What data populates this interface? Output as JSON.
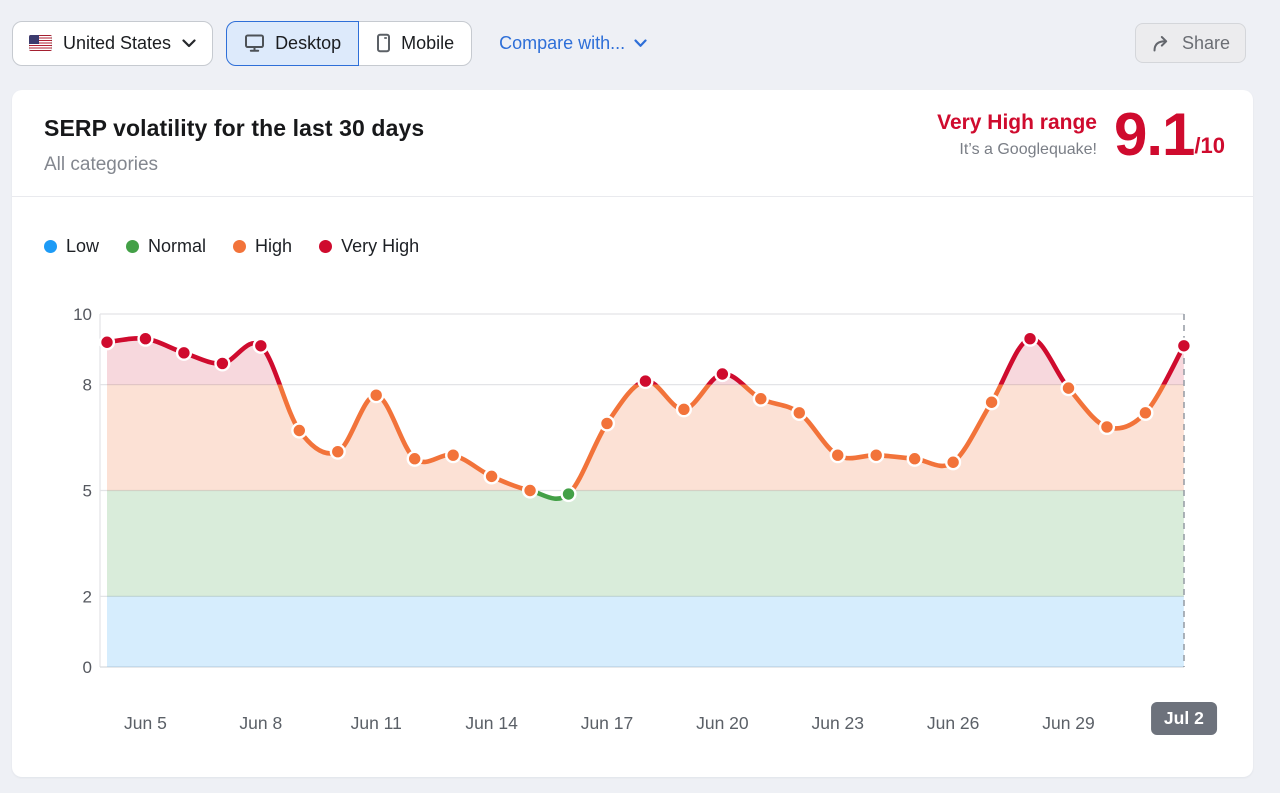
{
  "toolbar": {
    "country_selector": {
      "label": "United States",
      "flag_icon": "us-flag",
      "chevron_icon": "chevron-down"
    },
    "device_toggle": {
      "desktop_label": "Desktop",
      "mobile_label": "Mobile",
      "selected": "Desktop",
      "desktop_icon": "monitor",
      "mobile_icon": "smartphone"
    },
    "compare": {
      "label": "Compare with...",
      "chevron_icon": "chevron-down"
    },
    "share": {
      "label": "Share",
      "icon": "share-arrow"
    }
  },
  "card": {
    "title": "SERP volatility for the last 30 days",
    "subtitle": "All categories",
    "score": {
      "range_label": "Very High range",
      "caption": "It’s a Googlequake!",
      "value": "9.1",
      "out_of": "/10",
      "color": "#cf0b2e"
    }
  },
  "legend": {
    "items": [
      {
        "label": "Low",
        "color": "#1d9bf6"
      },
      {
        "label": "Normal",
        "color": "#43a047"
      },
      {
        "label": "High",
        "color": "#f2733a"
      },
      {
        "label": "Very High",
        "color": "#cf0b2e"
      }
    ]
  },
  "chart_data": {
    "type": "area",
    "title": "SERP volatility for the last 30 days",
    "x": [
      "Jun 4",
      "Jun 5",
      "Jun 6",
      "Jun 7",
      "Jun 8",
      "Jun 9",
      "Jun 10",
      "Jun 11",
      "Jun 12",
      "Jun 13",
      "Jun 14",
      "Jun 15",
      "Jun 16",
      "Jun 17",
      "Jun 18",
      "Jun 19",
      "Jun 20",
      "Jun 21",
      "Jun 22",
      "Jun 23",
      "Jun 24",
      "Jun 25",
      "Jun 26",
      "Jun 27",
      "Jun 28",
      "Jun 29",
      "Jun 30",
      "Jul 1",
      "Jul 2"
    ],
    "values": [
      9.2,
      9.3,
      8.9,
      8.6,
      9.1,
      6.7,
      6.1,
      7.7,
      5.9,
      6.0,
      5.4,
      5.0,
      4.9,
      6.9,
      8.1,
      7.3,
      8.3,
      7.6,
      7.2,
      6.0,
      6.0,
      5.9,
      5.8,
      7.5,
      9.3,
      7.9,
      6.8,
      7.2,
      9.1
    ],
    "ylim": [
      0,
      10
    ],
    "y_ticks": [
      0,
      2,
      5,
      8,
      10
    ],
    "x_tick_indices": [
      1,
      4,
      7,
      10,
      13,
      16,
      19,
      22,
      25,
      28
    ],
    "highlighted_x_label": "Jul 2",
    "grid": true,
    "legend_position": "top-left",
    "current_day_marker": "Jul 2",
    "zones": [
      {
        "name": "Low",
        "range": [
          0,
          2
        ],
        "line_color": "#1d9bf6",
        "band_rgb": [
          29,
          155,
          246
        ],
        "band_alpha": 0.18
      },
      {
        "name": "Normal",
        "range": [
          2,
          5
        ],
        "line_color": "#43a047",
        "band_rgb": [
          67,
          160,
          71
        ],
        "band_alpha": 0.2
      },
      {
        "name": "High",
        "range": [
          5,
          8
        ],
        "line_color": "#f2733a",
        "band_rgb": [
          242,
          115,
          58
        ],
        "band_alpha": 0.21
      },
      {
        "name": "Very High",
        "range": [
          8,
          10
        ],
        "line_color": "#cf0b2e",
        "band_rgb": [
          207,
          11,
          46
        ],
        "band_alpha": 0.16
      }
    ]
  }
}
